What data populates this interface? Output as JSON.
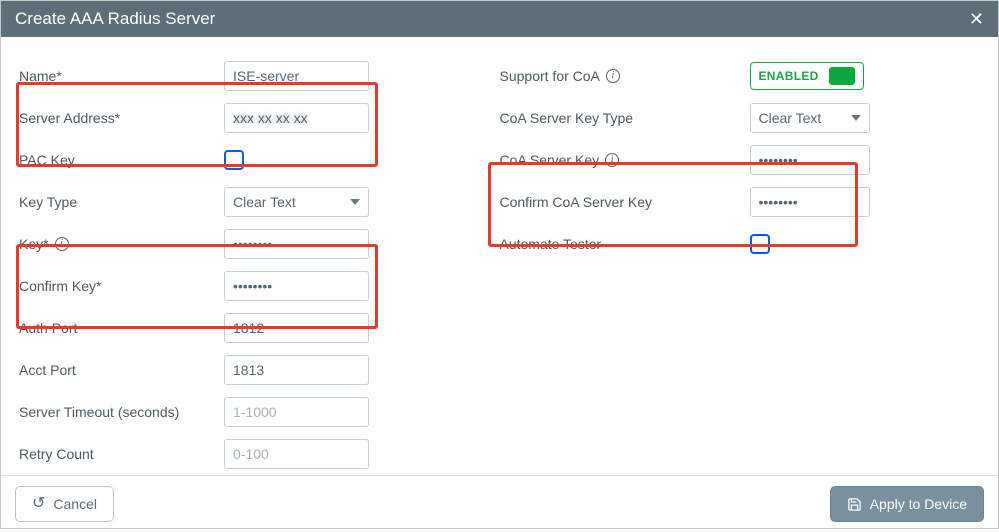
{
  "header": {
    "title": "Create AAA Radius Server"
  },
  "left": {
    "name_label": "Name*",
    "name_value": "ISE-server",
    "server_address_label": "Server Address*",
    "server_address_value": "xxx xx xx xx",
    "pac_key_label": "PAC Key",
    "key_type_label": "Key Type",
    "key_type_value": "Clear Text",
    "key_label": "Key*",
    "key_value": "••••••••",
    "confirm_key_label": "Confirm Key*",
    "confirm_key_value": "••••••••",
    "auth_port_label": "Auth Port",
    "auth_port_value": "1812",
    "acct_port_label": "Acct Port",
    "acct_port_value": "1813",
    "server_timeout_label": "Server Timeout (seconds)",
    "server_timeout_placeholder": "1-1000",
    "retry_count_label": "Retry Count",
    "retry_count_placeholder": "0-100"
  },
  "right": {
    "support_coa_label": "Support for CoA",
    "support_coa_state": "ENABLED",
    "coa_key_type_label": "CoA Server Key Type",
    "coa_key_type_value": "Clear Text",
    "coa_key_label": "CoA Server Key",
    "coa_key_value": "••••••••",
    "confirm_coa_key_label": "Confirm CoA Server Key",
    "confirm_coa_key_value": "••••••••",
    "automate_tester_label": "Automate Tester"
  },
  "footer": {
    "cancel": "Cancel",
    "apply": "Apply to Device"
  }
}
